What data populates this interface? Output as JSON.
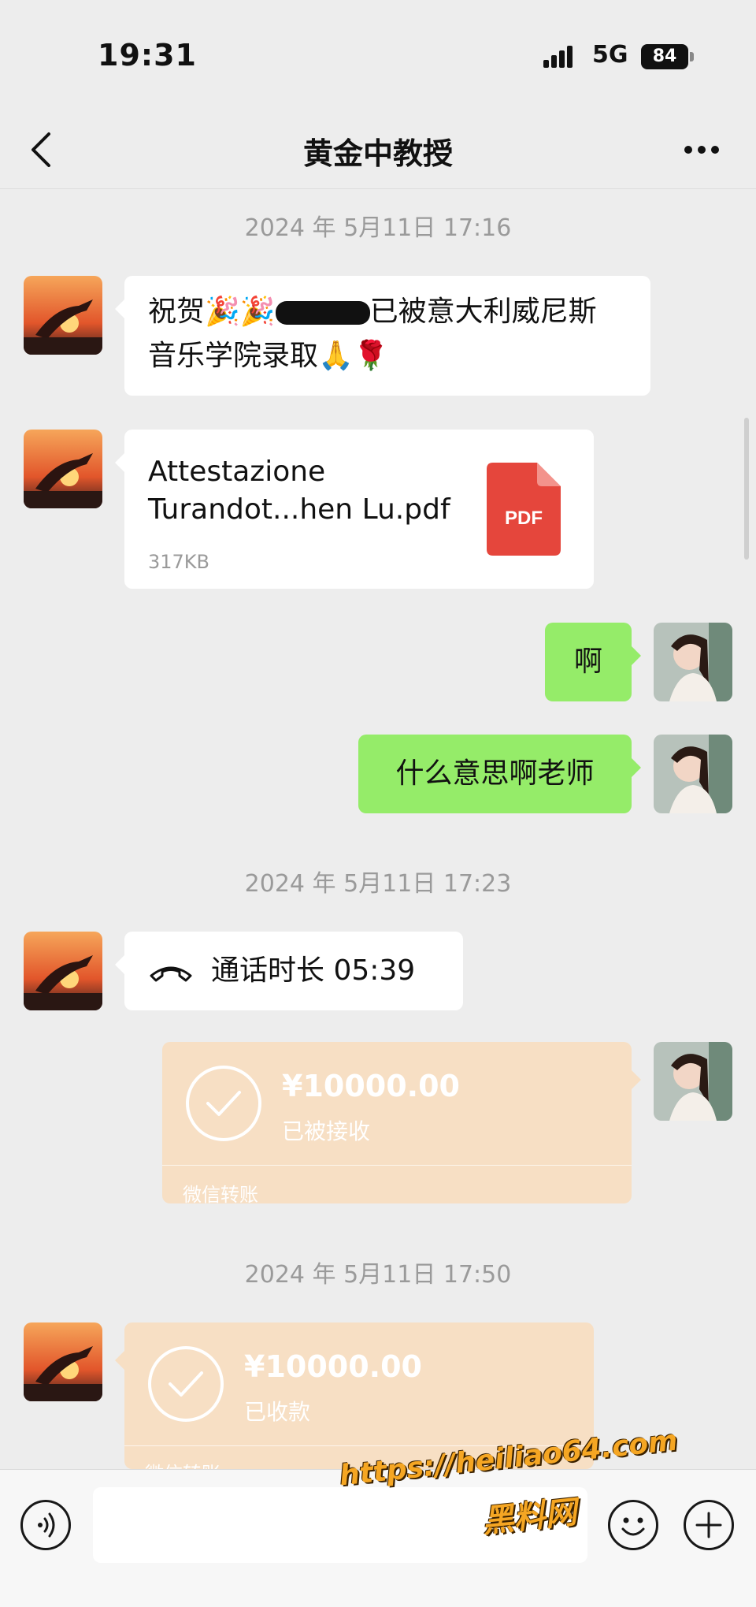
{
  "status_bar": {
    "time": "19:31",
    "network": "5G",
    "battery": "84"
  },
  "header": {
    "title": "黄金中教授"
  },
  "messages": {
    "ts1": "2024 年 5月11日 17:16",
    "msg1_a": "祝贺🎉🎉",
    "msg1_b": "已被意大利威尼斯",
    "msg1_c": "音乐学院录取🙏🌹",
    "file": {
      "name_line1": "Attestazione",
      "name_line2": "Turandot...hen Lu.pdf",
      "size": "317KB",
      "icon_label": "PDF"
    },
    "msg_a": "啊",
    "msg_b": "什么意思啊老师",
    "ts2": "2024 年 5月11日 17:23",
    "call": "通话时长 05:39",
    "transfer1": {
      "amount": "¥10000.00",
      "status": "已被接收",
      "label": "微信转账"
    },
    "ts3": "2024 年 5月11日 17:50",
    "transfer2": {
      "amount": "¥10000.00",
      "status": "已收款",
      "label": "微信转账"
    }
  },
  "watermark": {
    "line1": "https://heiliao64.com",
    "line2": "黑料网"
  },
  "colors": {
    "background": "#ededed",
    "sent_bubble": "#95ec69",
    "transfer_bubble": "#f7dfc4"
  },
  "icons": [
    "back-arrow-icon",
    "more-icon",
    "pdf-file-icon",
    "phone-call-icon",
    "check-circle-icon",
    "voice-icon",
    "emoji-icon",
    "plus-icon"
  ]
}
